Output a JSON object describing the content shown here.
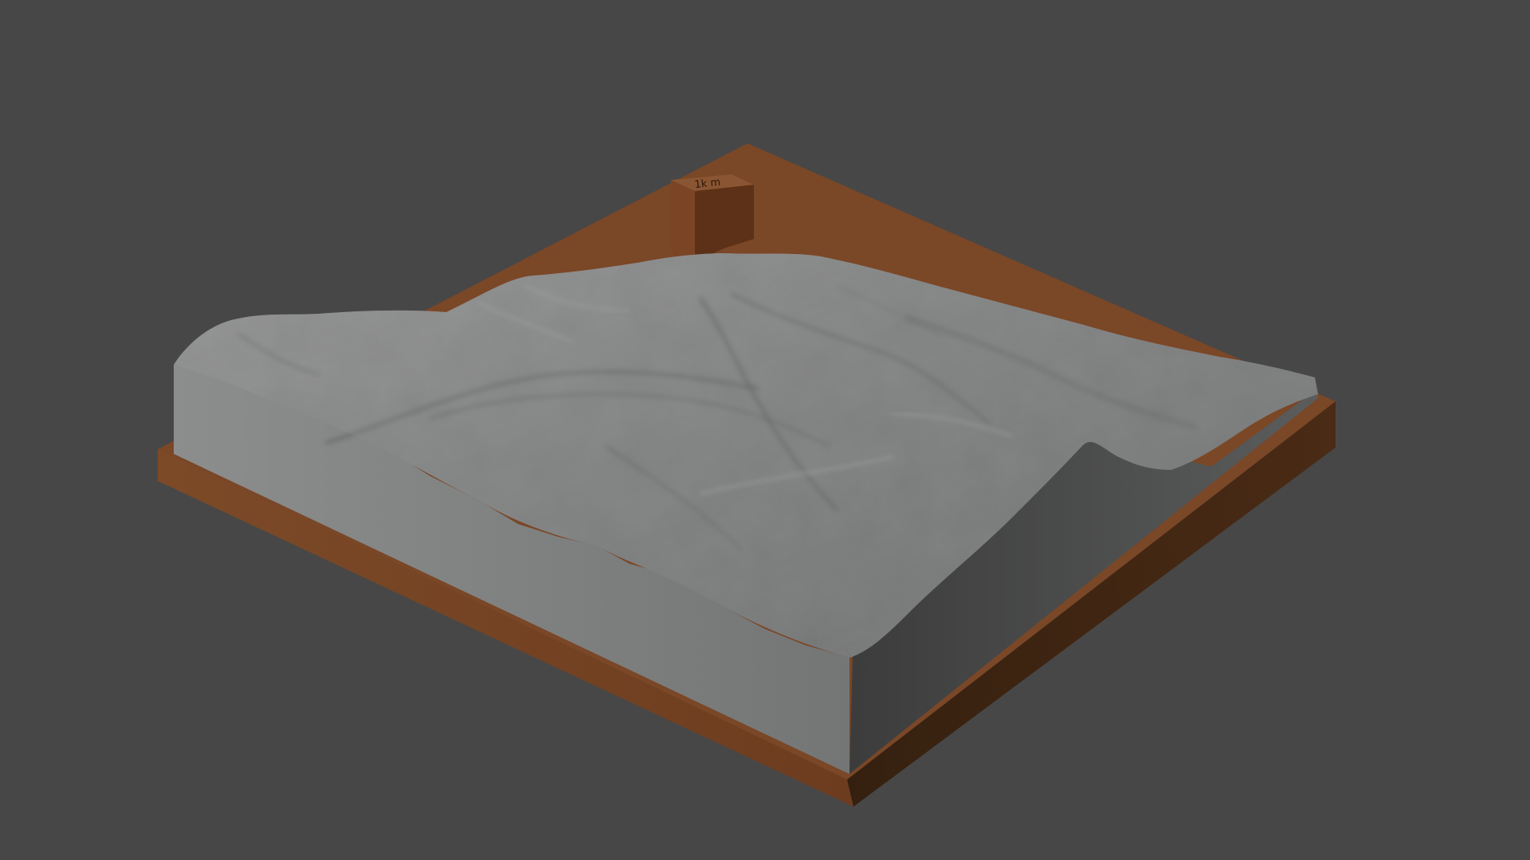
{
  "scene": {
    "background_color": "#474747",
    "objects": [
      {
        "name": "terrain-relief-model",
        "color": "#8a8b8b"
      },
      {
        "name": "base-plate",
        "color": "#7a4727"
      },
      {
        "name": "label-block",
        "color": "#7b4424"
      }
    ],
    "label_block": {
      "engraved_text": "1k m"
    }
  }
}
